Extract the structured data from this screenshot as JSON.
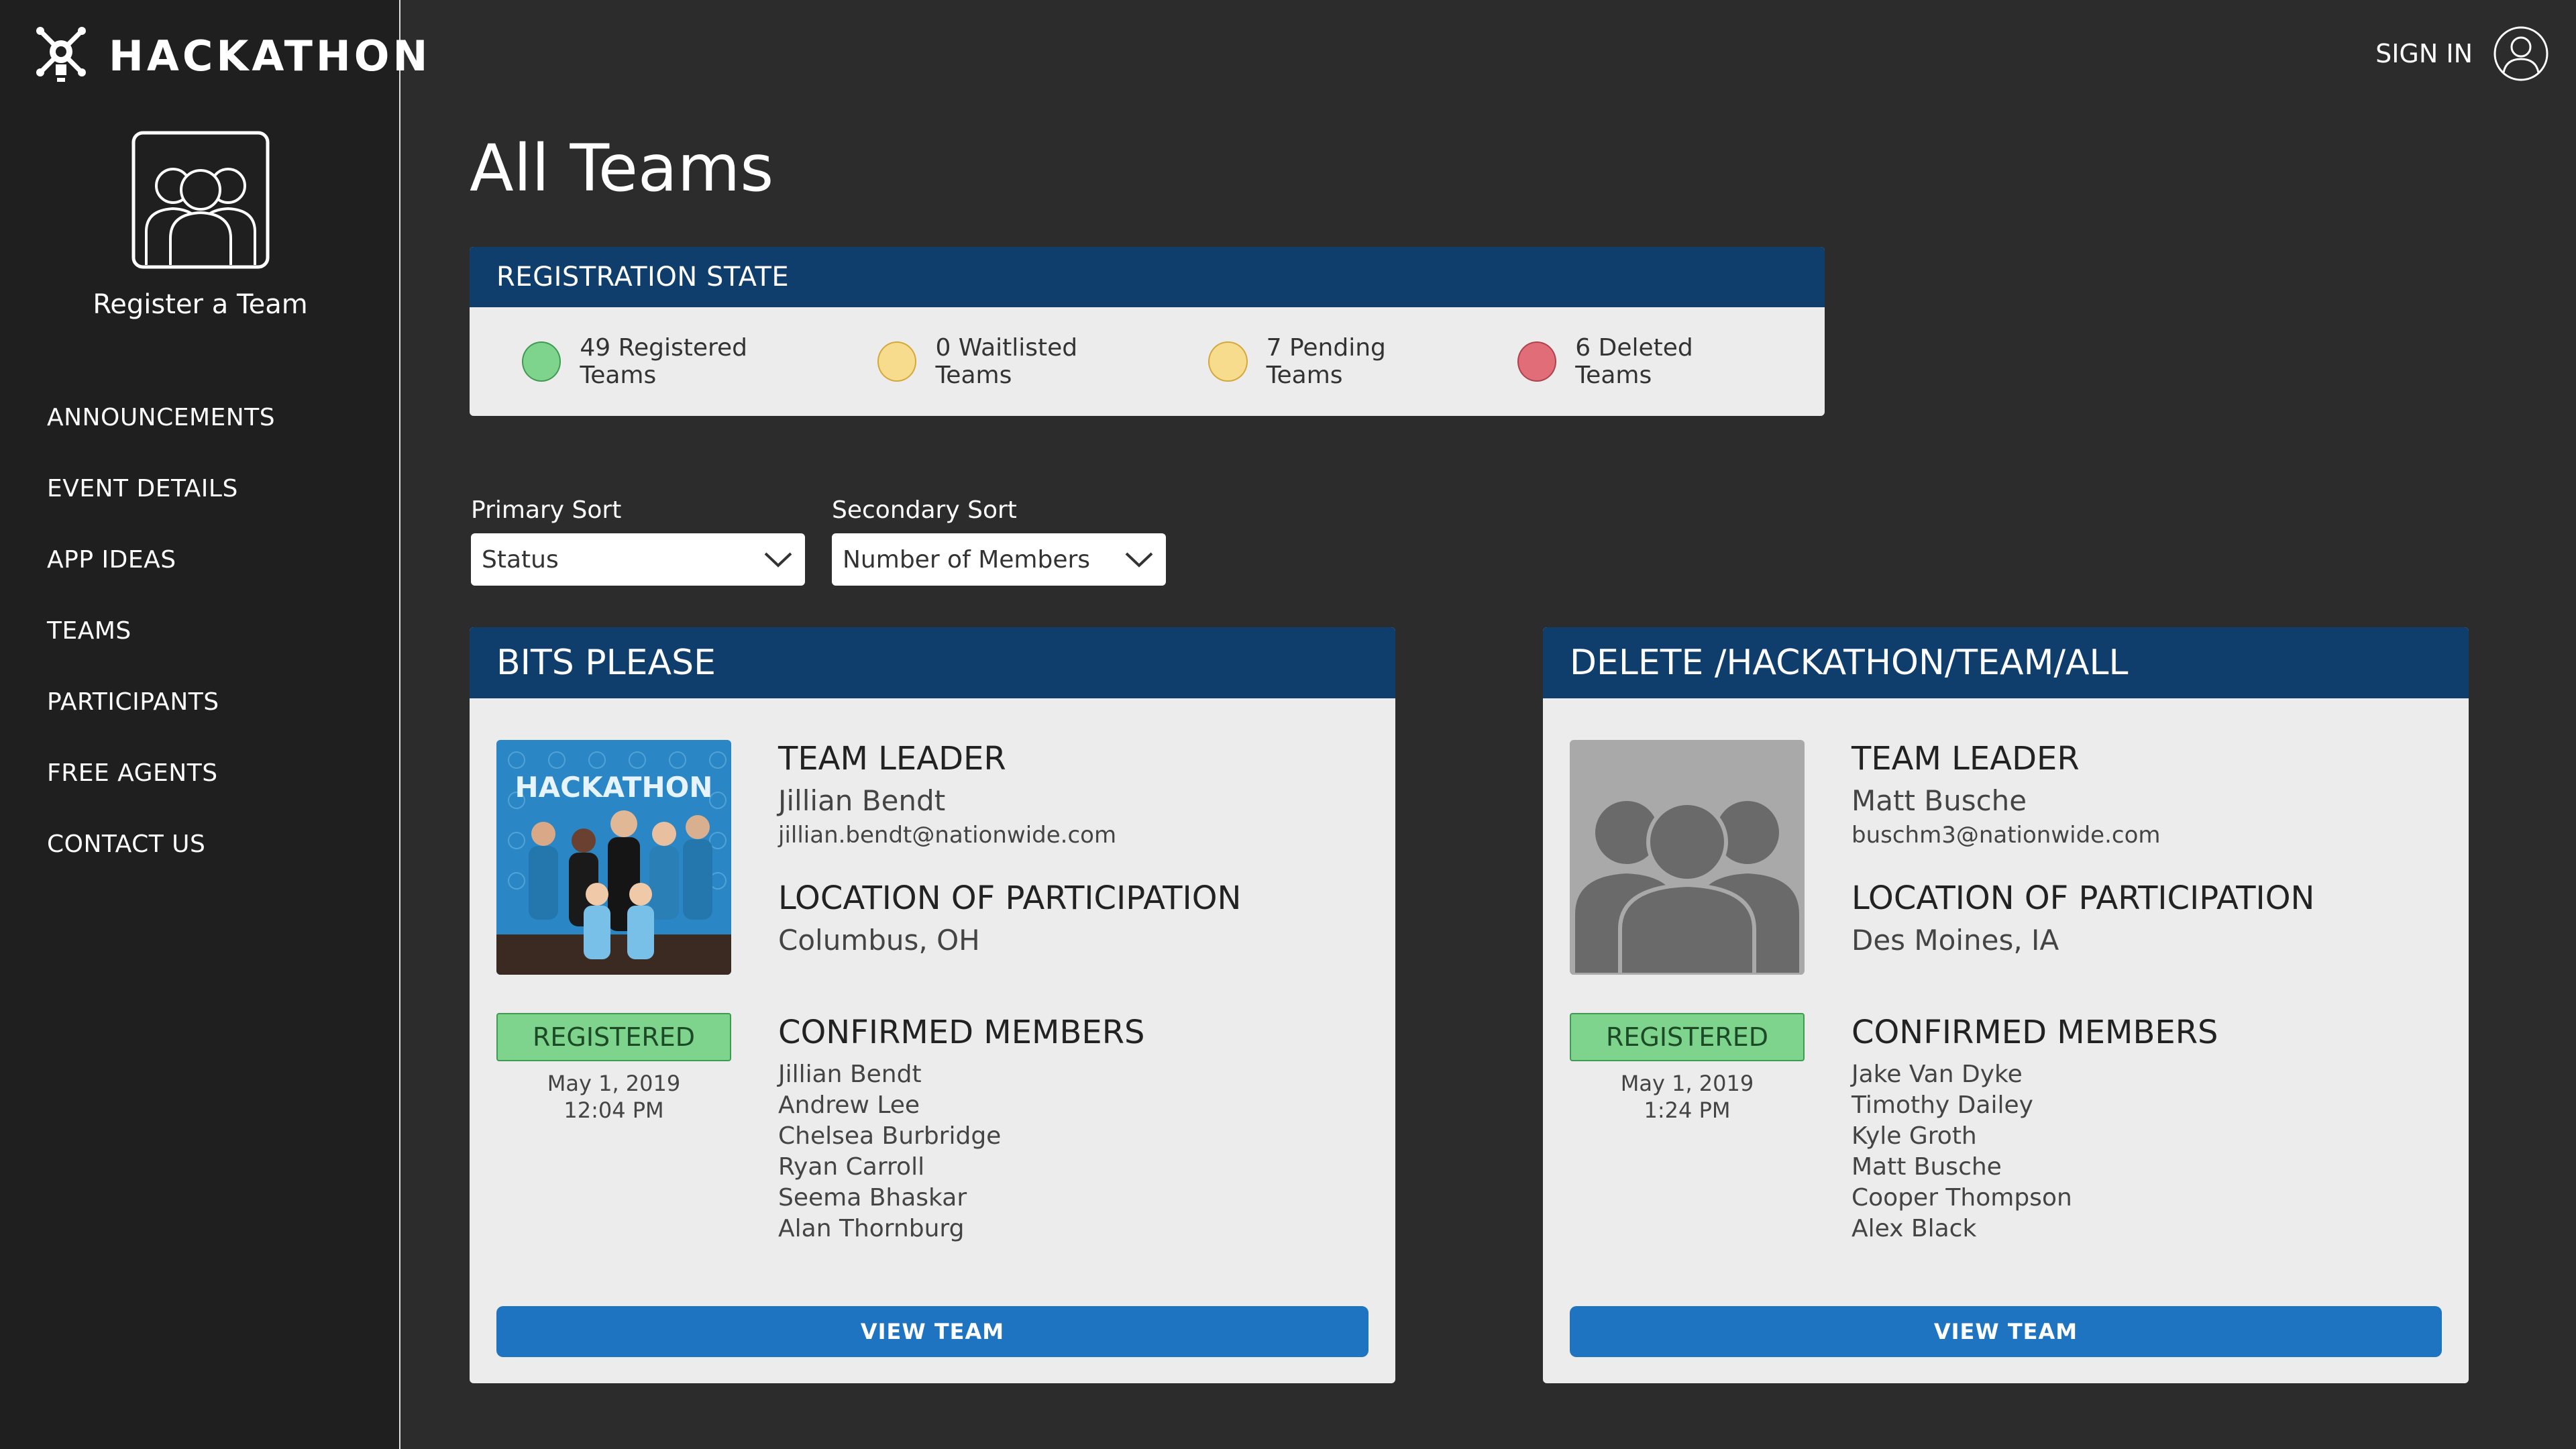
{
  "brand": {
    "name": "HACKATHON",
    "logo_icon": "gear-lightbulb-icon"
  },
  "sidebar": {
    "register": {
      "label": "Register a Team",
      "icon": "team-icon"
    },
    "nav": [
      {
        "label": "ANNOUNCEMENTS"
      },
      {
        "label": "EVENT DETAILS"
      },
      {
        "label": "APP IDEAS"
      },
      {
        "label": "TEAMS"
      },
      {
        "label": "PARTICIPANTS"
      },
      {
        "label": "FREE AGENTS"
      },
      {
        "label": "CONTACT US"
      }
    ]
  },
  "header": {
    "signin_label": "SIGN IN",
    "user_icon": "user-avatar-icon"
  },
  "main": {
    "title": "All Teams",
    "registration_state": {
      "title": "REGISTRATION STATE",
      "stats": [
        {
          "label": "49 Registered Teams",
          "color": "#7fd48d"
        },
        {
          "label": "0 Waitlisted Teams",
          "color": "#f7dc8e"
        },
        {
          "label": "7 Pending Teams",
          "color": "#f7dc8e"
        },
        {
          "label": "6 Deleted Teams",
          "color": "#e06d78"
        }
      ]
    },
    "sort": {
      "primary": {
        "label": "Primary Sort",
        "value": "Status"
      },
      "secondary": {
        "label": "Secondary Sort",
        "value": "Number of Members"
      }
    },
    "teams": [
      {
        "name": "BITS PLEASE",
        "leader_title": "TEAM LEADER",
        "leader_name": "Jillian Bendt",
        "leader_email": "jillian.bendt@nationwide.com",
        "location_title": "LOCATION OF PARTICIPATION",
        "location": "Columbus, OH",
        "status": "REGISTERED",
        "date": "May 1, 2019",
        "time": "12:04 PM",
        "members_title": "CONFIRMED MEMBERS",
        "members": [
          "Jillian Bendt",
          "Andrew Lee",
          "Chelsea Burbridge",
          "Ryan Carroll",
          "Seema Bhaskar",
          "Alan Thornburg"
        ],
        "photo_text": "HACKATHON",
        "button": "VIEW TEAM"
      },
      {
        "name": "DELETE /HACKATHON/TEAM/ALL",
        "leader_title": "TEAM LEADER",
        "leader_name": "Matt Busche",
        "leader_email": "buschm3@nationwide.com",
        "location_title": "LOCATION OF PARTICIPATION",
        "location": "Des Moines, IA",
        "status": "REGISTERED",
        "date": "May 1, 2019",
        "time": "1:24 PM",
        "members_title": "CONFIRMED MEMBERS",
        "members": [
          "Jake Van Dyke",
          "Timothy Dailey",
          "Kyle Groth",
          "Matt Busche",
          "Cooper Thompson",
          "Alex Black"
        ],
        "button": "VIEW TEAM"
      }
    ]
  }
}
